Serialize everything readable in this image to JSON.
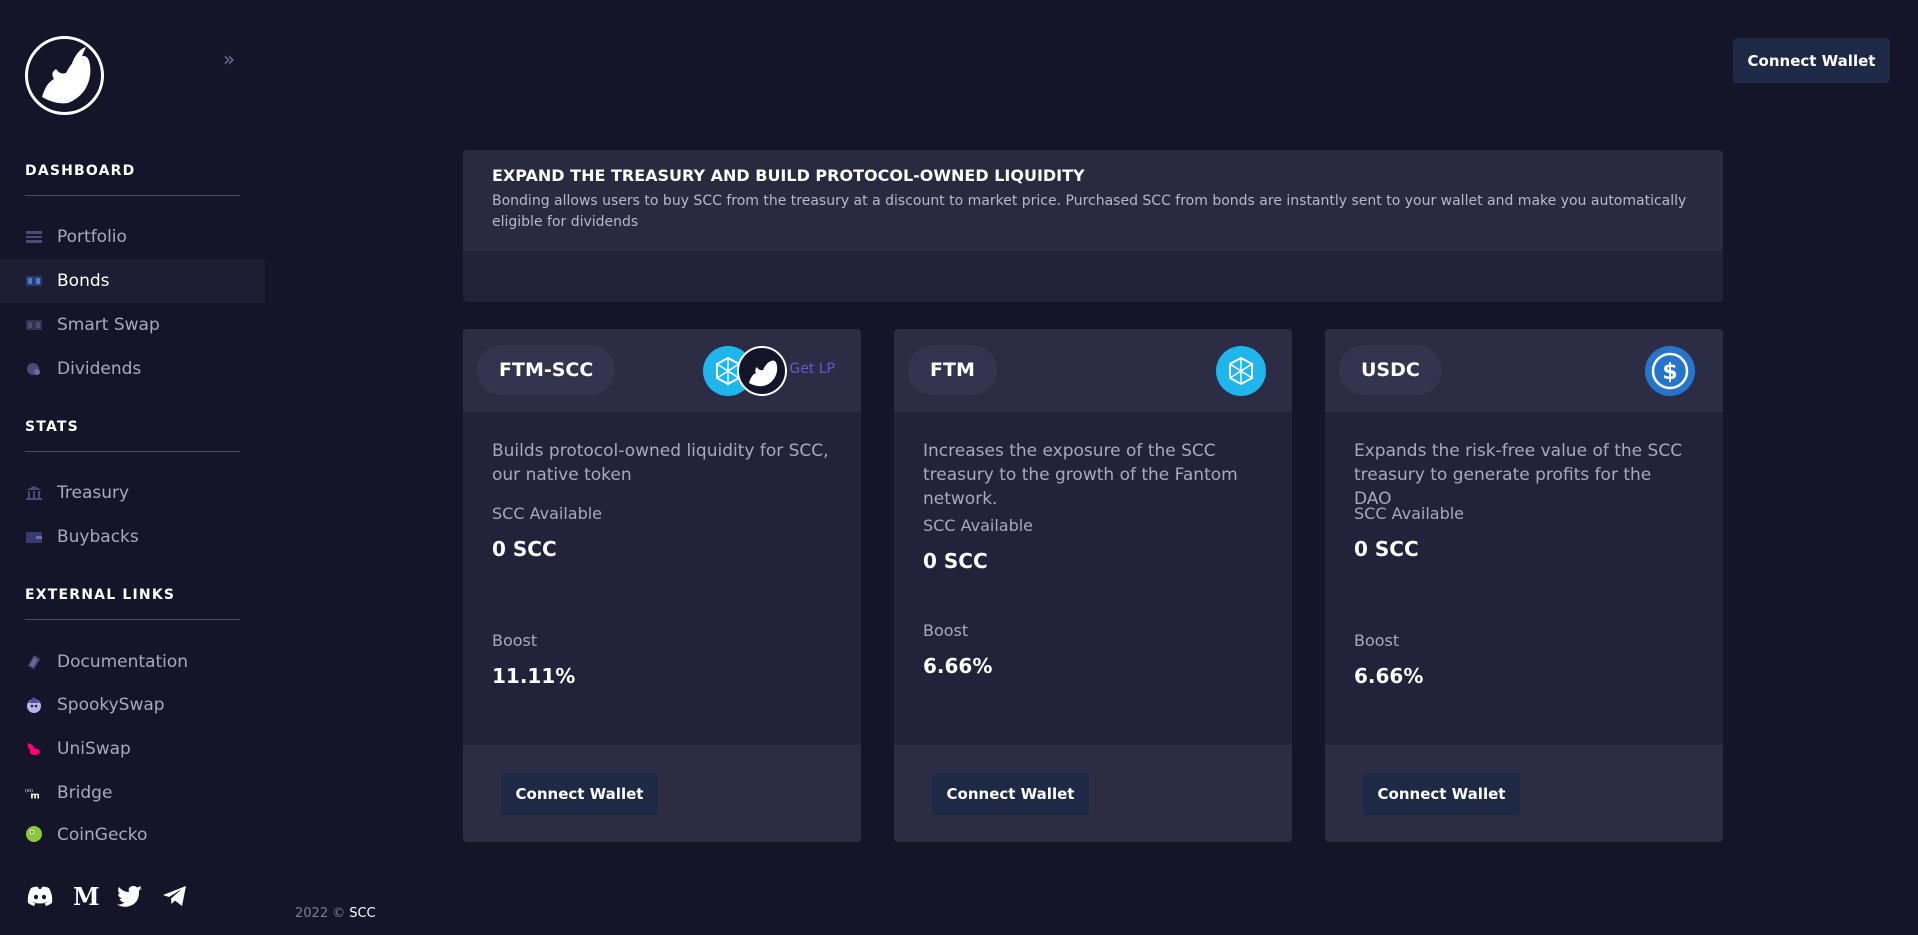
{
  "header": {
    "connect_label": "Connect Wallet"
  },
  "sidebar": {
    "sections": [
      {
        "title": "DASHBOARD",
        "items": [
          {
            "label": "Portfolio",
            "icon": "portfolio-icon"
          },
          {
            "label": "Bonds",
            "icon": "bonds-icon",
            "active": true
          },
          {
            "label": "Smart Swap",
            "icon": "swap-icon"
          },
          {
            "label": "Dividends",
            "icon": "dividends-icon"
          }
        ]
      },
      {
        "title": "STATS",
        "items": [
          {
            "label": "Treasury",
            "icon": "bank-icon"
          },
          {
            "label": "Buybacks",
            "icon": "wallet-icon"
          }
        ]
      },
      {
        "title": "EXTERNAL LINKS",
        "items": [
          {
            "label": "Documentation",
            "icon": "docs-icon"
          },
          {
            "label": "SpookySwap",
            "icon": "spookyswap-icon"
          },
          {
            "label": "UniSwap",
            "icon": "uniswap-icon"
          },
          {
            "label": "Bridge",
            "icon": "bridge-icon"
          },
          {
            "label": "CoinGecko",
            "icon": "coingecko-icon"
          }
        ]
      }
    ],
    "socials": [
      "discord-icon",
      "medium-icon",
      "twitter-icon",
      "telegram-icon"
    ]
  },
  "banner": {
    "title": "EXPAND THE TREASURY AND BUILD PROTOCOL-OWNED LIQUIDITY",
    "text": "Bonding allows users to buy SCC from the treasury at a discount to market price. Purchased SCC from bonds are instantly sent to your wallet and make you automatically eligible for dividends"
  },
  "bonds": [
    {
      "name": "FTM-SCC",
      "description": "Builds protocol-owned liquidity for SCC, our native token",
      "available_label": "SCC Available",
      "available_value": "0 SCC",
      "boost_label": "Boost",
      "boost_value": "11.11%",
      "get_lp": "Get LP",
      "button": "Connect Wallet"
    },
    {
      "name": "FTM",
      "description": "Increases the exposure of the SCC treasury to the growth of the Fantom network.",
      "available_label": "SCC Available",
      "available_value": "0 SCC",
      "boost_label": "Boost",
      "boost_value": "6.66%",
      "button": "Connect Wallet"
    },
    {
      "name": "USDC",
      "description": "Expands the risk-free value of the SCC treasury to generate profits for the DAO",
      "available_label": "SCC Available",
      "available_value": "0 SCC",
      "boost_label": "Boost",
      "boost_value": "6.66%",
      "button": "Connect Wallet"
    }
  ],
  "footer": {
    "year": "2022 ©",
    "brand": "SCC"
  },
  "colors": {
    "background": "#15152a",
    "card": "#22223a",
    "card_header": "#2c2c45",
    "button": "#1e2a45",
    "fantom_blue": "#1fb6ed",
    "usdc_blue": "#2775ca",
    "lp_link": "#6f55c8"
  }
}
